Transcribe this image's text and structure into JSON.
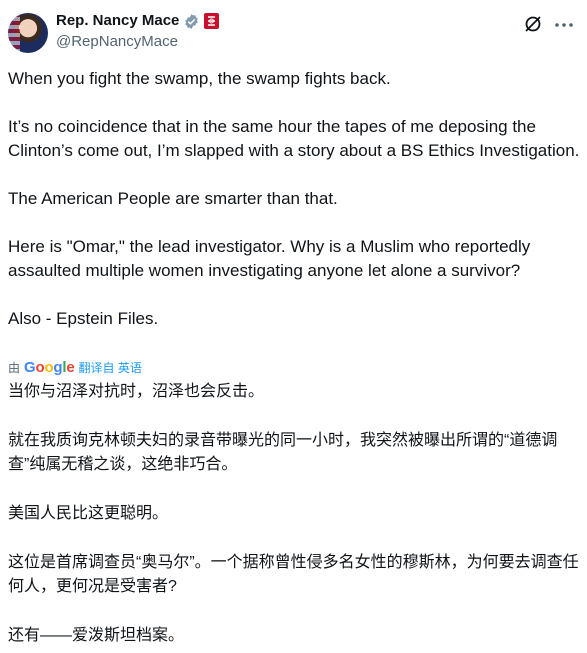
{
  "author": {
    "display_name": "Rep. Nancy Mace",
    "handle": "@RepNancyMace",
    "verified_icon": "verified-badge-gray",
    "affiliation_icon": "us-government-icon"
  },
  "actions": {
    "grok_icon": "grok-icon",
    "more_icon": "more-icon"
  },
  "post": {
    "text": "When you fight the swamp, the swamp fights back.\n\nIt’s no coincidence that in the same hour the tapes of me deposing the Clinton’s come out, I’m slapped with a story about a BS Ethics Investigation.\n\nThe American People are smarter than that.\n\nHere is \"Omar,\" the lead investigator. Why is a Muslim who reportedly assaulted multiple women investigating anyone let alone a survivor?\n\nAlso - Epstein Files."
  },
  "translation": {
    "by_label": "由",
    "provider": "Google",
    "translated_from_label": "翻译自 英语",
    "text": "当你与沼泽对抗时，沼泽也会反击。\n\n就在我质询克林顿夫妇的录音带曝光的同一小时，我突然被曝出所谓的“道德调查”纯属无稽之谈，这绝非巧合。\n\n美国人民比这更聪明。\n\n这位是首席调查员“奥马尔”。一个据称曾性侵多名女性的穆斯林，为何要去调查任何人，更何况是受害者?\n\n还有——爱泼斯坦档案。"
  },
  "colors": {
    "text": "#0f1419",
    "secondary": "#536471",
    "link": "#1d9bf0"
  }
}
